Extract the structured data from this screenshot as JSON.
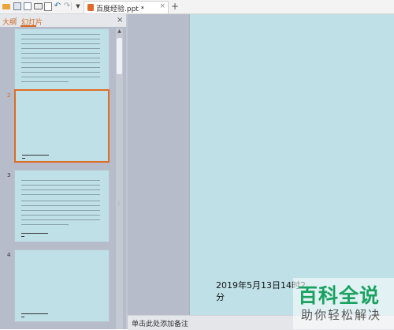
{
  "toolbar": {
    "tab_title": "百度经验.ppt *",
    "tab_close": "×",
    "new_tab": "+",
    "undo": "↶",
    "redo": "↷",
    "dropdown": "▼"
  },
  "panel": {
    "tabs": [
      "大纲",
      "幻灯片"
    ],
    "close": "×"
  },
  "slides": [
    {
      "number": "2"
    },
    {
      "number": "3"
    },
    {
      "number": "4"
    }
  ],
  "main": {
    "date_line1": "2019年5月13日14时2",
    "date_line2": "分"
  },
  "notes": {
    "hint": "单击此处添加备注"
  },
  "watermark": {
    "main": "百科全说",
    "sub": "助你轻松解决"
  },
  "colors": {
    "slide_bg": "#bfe0e7",
    "selected_border": "#e06b26",
    "panel_bg": "#b6bcc9",
    "watermark_green": "#1aa260"
  }
}
